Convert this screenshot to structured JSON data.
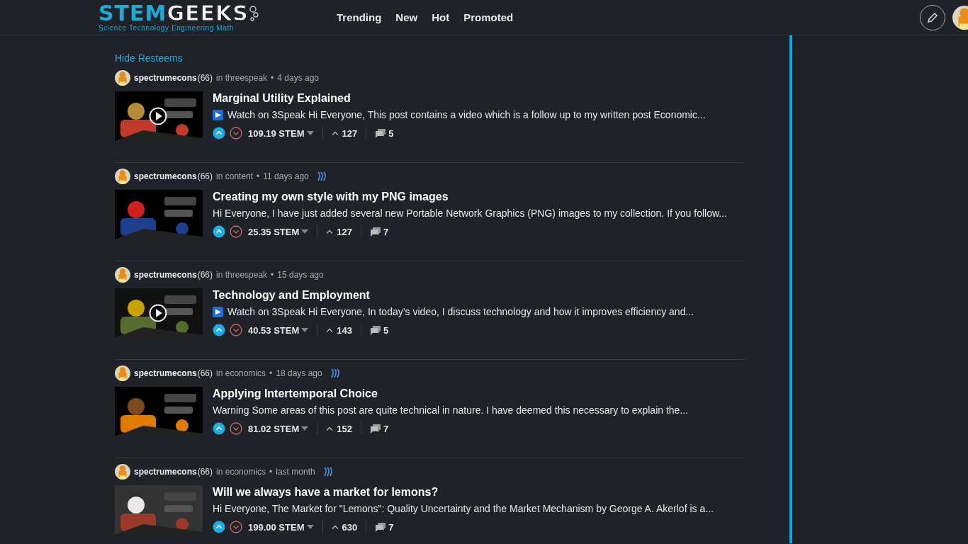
{
  "header": {
    "logo": {
      "primary": "STEM",
      "secondary": "GEEKS",
      "tagline": "Science Technology Engineering Math"
    },
    "nav": [
      {
        "label": "Trending"
      },
      {
        "label": "New"
      },
      {
        "label": "Hot"
      },
      {
        "label": "Promoted"
      }
    ]
  },
  "feed": {
    "hide_resteems": "Hide Resteems",
    "posts": [
      {
        "author": "spectrumecons",
        "reputation": "(66)",
        "community": "in threespeak",
        "separator": "•",
        "time": "4 days ago",
        "steem": false,
        "video": true,
        "title": "Marginal Utility Explained",
        "badge": "▶",
        "excerpt": "Watch on 3Speak Hi Everyone, This post contains a video which is a follow up to my written post Economic...",
        "payout": "109.19 STEM",
        "voted": true,
        "votes": "127",
        "comments": "5"
      },
      {
        "author": "spectrumecons",
        "reputation": "(66)",
        "community": "in content",
        "separator": "•",
        "time": "11 days ago",
        "steem": true,
        "video": false,
        "title": "Creating my own style with my PNG images",
        "excerpt": "Hi Everyone, I have just added several new Portable Network Graphics (PNG) images to my collection. If you follow...",
        "payout": "25.35 STEM",
        "voted": true,
        "votes": "127",
        "comments": "7"
      },
      {
        "author": "spectrumecons",
        "reputation": "(66)",
        "community": "in threespeak",
        "separator": "•",
        "time": "15 days ago",
        "steem": false,
        "video": true,
        "title": "Technology and Employment",
        "badge": "▶",
        "excerpt": "Watch on 3Speak Hi Everyone, In today’s video, I discuss technology and how it improves efficiency and...",
        "payout": "40.53 STEM",
        "voted": true,
        "votes": "143",
        "comments": "5"
      },
      {
        "author": "spectrumecons",
        "reputation": "(66)",
        "community": "in economics",
        "separator": "•",
        "time": "18 days ago",
        "steem": true,
        "video": false,
        "title": "Applying Intertemporal Choice",
        "excerpt": "Warning Some areas of this post are quite technical in nature. I have deemed this necessary to explain the...",
        "payout": "81.02 STEM",
        "voted": true,
        "votes": "152",
        "comments": "7"
      },
      {
        "author": "spectrumecons",
        "reputation": "(66)",
        "community": "in economics",
        "separator": "•",
        "time": "last month",
        "steem": true,
        "video": false,
        "title": "Will we always have a market for lemons?",
        "excerpt": "Hi Everyone, The Market for \"Lemons\": Quality Uncertainty and the Market Mechanism by George A. Akerlof is a...",
        "payout": "199.00 STEM",
        "voted": true,
        "votes": "630",
        "comments": "7"
      }
    ]
  }
}
